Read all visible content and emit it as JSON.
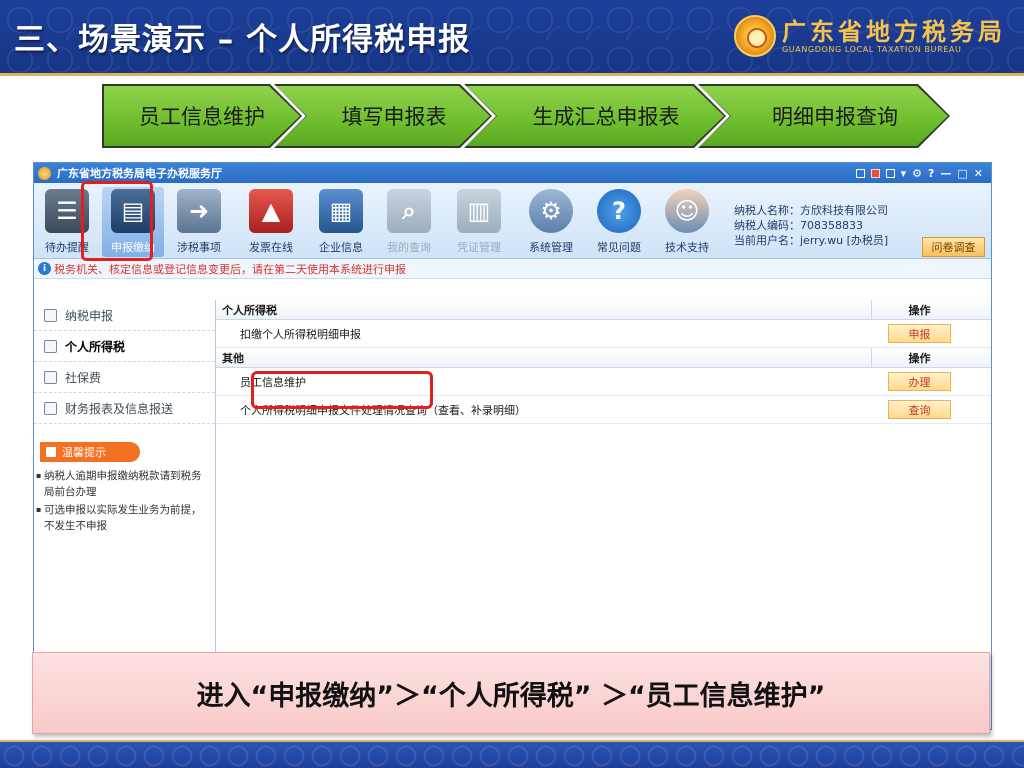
{
  "slide": {
    "title": "三、场景演示 – 个人所得税申报",
    "bureau_cn": "广东省地方税务局",
    "bureau_en": "GUANGDONG LOCAL TAXATION BUREAU"
  },
  "steps": [
    "员工信息维护",
    "填写申报表",
    "生成汇总申报表",
    "明细申报查询"
  ],
  "app": {
    "title": "广东省地方税务局电子办税服务厅",
    "title_controls": "? — □ ×",
    "toolbar": [
      {
        "label": "待办提醒",
        "icon": "clipboard-icon",
        "state": "normal"
      },
      {
        "label": "申报缴纳",
        "icon": "computer-coins-icon",
        "state": "active"
      },
      {
        "label": "涉税事项",
        "icon": "document-arrow-icon",
        "state": "normal"
      },
      {
        "label": "发票在线",
        "icon": "stamp-icon",
        "state": "normal"
      },
      {
        "label": "企业信息",
        "icon": "building-icon",
        "state": "normal"
      },
      {
        "label": "我的查询",
        "icon": "magnifier-icon",
        "state": "disabled"
      },
      {
        "label": "凭证管理",
        "icon": "books-icon",
        "state": "disabled"
      },
      {
        "label": "系统管理",
        "icon": "gear-icon",
        "state": "normal"
      },
      {
        "label": "常见问题",
        "icon": "question-icon",
        "state": "normal"
      },
      {
        "label": "技术支持",
        "icon": "support-agent-icon",
        "state": "normal"
      }
    ],
    "taxpayer": {
      "name_line": "纳税人名称：方欣科技有限公司",
      "code_line": "纳税人编码：708358833",
      "user_line": "当前用户名：jerry.wu [办税员]"
    },
    "survey_button": "问卷调查",
    "notice": "税务机关、核定信息或登记信息变更后，请在第二天使用本系统进行申报",
    "sidebar": {
      "items": [
        {
          "label": "纳税申报",
          "active": false
        },
        {
          "label": "个人所得税",
          "active": true
        },
        {
          "label": "社保费",
          "active": false
        },
        {
          "label": "财务报表及信息报送",
          "active": false
        }
      ],
      "tip_title": "温馨提示",
      "tips": [
        "纳税人逾期申报缴纳税款请到税务局前台办理",
        "可选申报以实际发生业务为前提，不发生不申报"
      ]
    },
    "sections": [
      {
        "title": "个人所得税",
        "op_header": "操作",
        "rows": [
          {
            "label": "扣缴个人所得税明细申报",
            "action": "申报"
          }
        ]
      },
      {
        "title": "其他",
        "op_header": "操作",
        "rows": [
          {
            "label": "员工信息维护",
            "action": "办理"
          },
          {
            "label": "个人所得税明细申报文件处理情况查询（查看、补录明细）",
            "action": "查询"
          }
        ]
      }
    ]
  },
  "caption": "进入“申报缴纳”＞“个人所得税” ＞“员工信息维护”",
  "colors": {
    "header_blue": "#1d3f9a",
    "step_green": "#6fbe2d",
    "highlight_red": "#e0201c",
    "caption_pink": "#fbd6d6"
  }
}
